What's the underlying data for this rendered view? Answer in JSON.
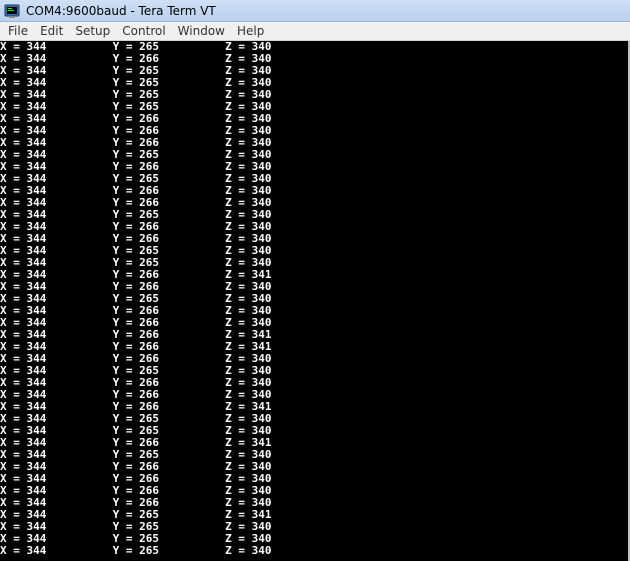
{
  "window": {
    "title": "COM4:9600baud - Tera Term VT",
    "icon": "tera-term-icon"
  },
  "menu": [
    "File",
    "Edit",
    "Setup",
    "Control",
    "Window",
    "Help"
  ],
  "readings": [
    {
      "x": "344",
      "y": "265",
      "z": "340"
    },
    {
      "x": "344",
      "y": "266",
      "z": "340"
    },
    {
      "x": "344",
      "y": "265",
      "z": "340"
    },
    {
      "x": "344",
      "y": "265",
      "z": "340"
    },
    {
      "x": "344",
      "y": "265",
      "z": "340"
    },
    {
      "x": "344",
      "y": "265",
      "z": "340"
    },
    {
      "x": "344",
      "y": "266",
      "z": "340"
    },
    {
      "x": "344",
      "y": "266",
      "z": "340"
    },
    {
      "x": "344",
      "y": "266",
      "z": "340"
    },
    {
      "x": "344",
      "y": "265",
      "z": "340"
    },
    {
      "x": "344",
      "y": "266",
      "z": "340"
    },
    {
      "x": "344",
      "y": "265",
      "z": "340"
    },
    {
      "x": "344",
      "y": "266",
      "z": "340"
    },
    {
      "x": "344",
      "y": "266",
      "z": "340"
    },
    {
      "x": "344",
      "y": "265",
      "z": "340"
    },
    {
      "x": "344",
      "y": "266",
      "z": "340"
    },
    {
      "x": "344",
      "y": "266",
      "z": "340"
    },
    {
      "x": "344",
      "y": "265",
      "z": "340"
    },
    {
      "x": "344",
      "y": "265",
      "z": "340"
    },
    {
      "x": "344",
      "y": "266",
      "z": "341"
    },
    {
      "x": "344",
      "y": "266",
      "z": "340"
    },
    {
      "x": "344",
      "y": "265",
      "z": "340"
    },
    {
      "x": "344",
      "y": "266",
      "z": "340"
    },
    {
      "x": "344",
      "y": "266",
      "z": "340"
    },
    {
      "x": "344",
      "y": "266",
      "z": "341"
    },
    {
      "x": "344",
      "y": "266",
      "z": "341"
    },
    {
      "x": "344",
      "y": "266",
      "z": "340"
    },
    {
      "x": "344",
      "y": "265",
      "z": "340"
    },
    {
      "x": "344",
      "y": "266",
      "z": "340"
    },
    {
      "x": "344",
      "y": "266",
      "z": "340"
    },
    {
      "x": "344",
      "y": "266",
      "z": "341"
    },
    {
      "x": "344",
      "y": "265",
      "z": "340"
    },
    {
      "x": "344",
      "y": "265",
      "z": "340"
    },
    {
      "x": "344",
      "y": "266",
      "z": "341"
    },
    {
      "x": "344",
      "y": "265",
      "z": "340"
    },
    {
      "x": "344",
      "y": "266",
      "z": "340"
    },
    {
      "x": "344",
      "y": "266",
      "z": "340"
    },
    {
      "x": "344",
      "y": "266",
      "z": "340"
    },
    {
      "x": "344",
      "y": "266",
      "z": "340"
    },
    {
      "x": "344",
      "y": "265",
      "z": "341"
    },
    {
      "x": "344",
      "y": "265",
      "z": "340"
    },
    {
      "x": "344",
      "y": "265",
      "z": "340"
    },
    {
      "x": "344",
      "y": "265",
      "z": "340"
    }
  ]
}
